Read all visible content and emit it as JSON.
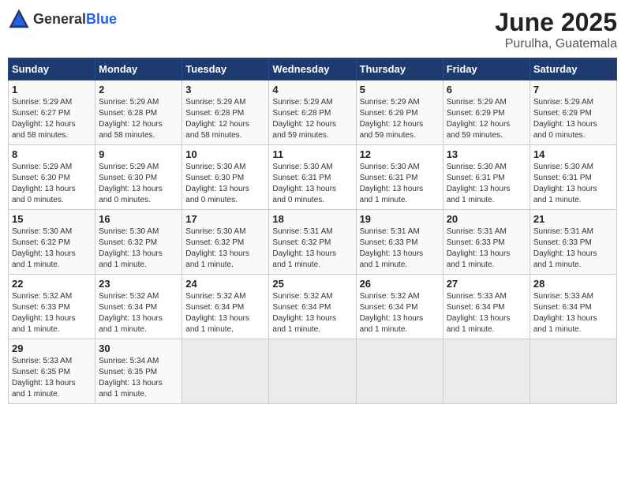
{
  "logo": {
    "general": "General",
    "blue": "Blue"
  },
  "title": "June 2025",
  "subtitle": "Purulha, Guatemala",
  "days_of_week": [
    "Sunday",
    "Monday",
    "Tuesday",
    "Wednesday",
    "Thursday",
    "Friday",
    "Saturday"
  ],
  "weeks": [
    [
      {
        "day": "1",
        "info": "Sunrise: 5:29 AM\nSunset: 6:27 PM\nDaylight: 12 hours\nand 58 minutes."
      },
      {
        "day": "2",
        "info": "Sunrise: 5:29 AM\nSunset: 6:28 PM\nDaylight: 12 hours\nand 58 minutes."
      },
      {
        "day": "3",
        "info": "Sunrise: 5:29 AM\nSunset: 6:28 PM\nDaylight: 12 hours\nand 58 minutes."
      },
      {
        "day": "4",
        "info": "Sunrise: 5:29 AM\nSunset: 6:28 PM\nDaylight: 12 hours\nand 59 minutes."
      },
      {
        "day": "5",
        "info": "Sunrise: 5:29 AM\nSunset: 6:29 PM\nDaylight: 12 hours\nand 59 minutes."
      },
      {
        "day": "6",
        "info": "Sunrise: 5:29 AM\nSunset: 6:29 PM\nDaylight: 12 hours\nand 59 minutes."
      },
      {
        "day": "7",
        "info": "Sunrise: 5:29 AM\nSunset: 6:29 PM\nDaylight: 13 hours\nand 0 minutes."
      }
    ],
    [
      {
        "day": "8",
        "info": "Sunrise: 5:29 AM\nSunset: 6:30 PM\nDaylight: 13 hours\nand 0 minutes."
      },
      {
        "day": "9",
        "info": "Sunrise: 5:29 AM\nSunset: 6:30 PM\nDaylight: 13 hours\nand 0 minutes."
      },
      {
        "day": "10",
        "info": "Sunrise: 5:30 AM\nSunset: 6:30 PM\nDaylight: 13 hours\nand 0 minutes."
      },
      {
        "day": "11",
        "info": "Sunrise: 5:30 AM\nSunset: 6:31 PM\nDaylight: 13 hours\nand 0 minutes."
      },
      {
        "day": "12",
        "info": "Sunrise: 5:30 AM\nSunset: 6:31 PM\nDaylight: 13 hours\nand 1 minute."
      },
      {
        "day": "13",
        "info": "Sunrise: 5:30 AM\nSunset: 6:31 PM\nDaylight: 13 hours\nand 1 minute."
      },
      {
        "day": "14",
        "info": "Sunrise: 5:30 AM\nSunset: 6:31 PM\nDaylight: 13 hours\nand 1 minute."
      }
    ],
    [
      {
        "day": "15",
        "info": "Sunrise: 5:30 AM\nSunset: 6:32 PM\nDaylight: 13 hours\nand 1 minute."
      },
      {
        "day": "16",
        "info": "Sunrise: 5:30 AM\nSunset: 6:32 PM\nDaylight: 13 hours\nand 1 minute."
      },
      {
        "day": "17",
        "info": "Sunrise: 5:30 AM\nSunset: 6:32 PM\nDaylight: 13 hours\nand 1 minute."
      },
      {
        "day": "18",
        "info": "Sunrise: 5:31 AM\nSunset: 6:32 PM\nDaylight: 13 hours\nand 1 minute."
      },
      {
        "day": "19",
        "info": "Sunrise: 5:31 AM\nSunset: 6:33 PM\nDaylight: 13 hours\nand 1 minute."
      },
      {
        "day": "20",
        "info": "Sunrise: 5:31 AM\nSunset: 6:33 PM\nDaylight: 13 hours\nand 1 minute."
      },
      {
        "day": "21",
        "info": "Sunrise: 5:31 AM\nSunset: 6:33 PM\nDaylight: 13 hours\nand 1 minute."
      }
    ],
    [
      {
        "day": "22",
        "info": "Sunrise: 5:32 AM\nSunset: 6:33 PM\nDaylight: 13 hours\nand 1 minute."
      },
      {
        "day": "23",
        "info": "Sunrise: 5:32 AM\nSunset: 6:34 PM\nDaylight: 13 hours\nand 1 minute."
      },
      {
        "day": "24",
        "info": "Sunrise: 5:32 AM\nSunset: 6:34 PM\nDaylight: 13 hours\nand 1 minute."
      },
      {
        "day": "25",
        "info": "Sunrise: 5:32 AM\nSunset: 6:34 PM\nDaylight: 13 hours\nand 1 minute."
      },
      {
        "day": "26",
        "info": "Sunrise: 5:32 AM\nSunset: 6:34 PM\nDaylight: 13 hours\nand 1 minute."
      },
      {
        "day": "27",
        "info": "Sunrise: 5:33 AM\nSunset: 6:34 PM\nDaylight: 13 hours\nand 1 minute."
      },
      {
        "day": "28",
        "info": "Sunrise: 5:33 AM\nSunset: 6:34 PM\nDaylight: 13 hours\nand 1 minute."
      }
    ],
    [
      {
        "day": "29",
        "info": "Sunrise: 5:33 AM\nSunset: 6:35 PM\nDaylight: 13 hours\nand 1 minute."
      },
      {
        "day": "30",
        "info": "Sunrise: 5:34 AM\nSunset: 6:35 PM\nDaylight: 13 hours\nand 1 minute."
      },
      {
        "day": "",
        "info": ""
      },
      {
        "day": "",
        "info": ""
      },
      {
        "day": "",
        "info": ""
      },
      {
        "day": "",
        "info": ""
      },
      {
        "day": "",
        "info": ""
      }
    ]
  ]
}
